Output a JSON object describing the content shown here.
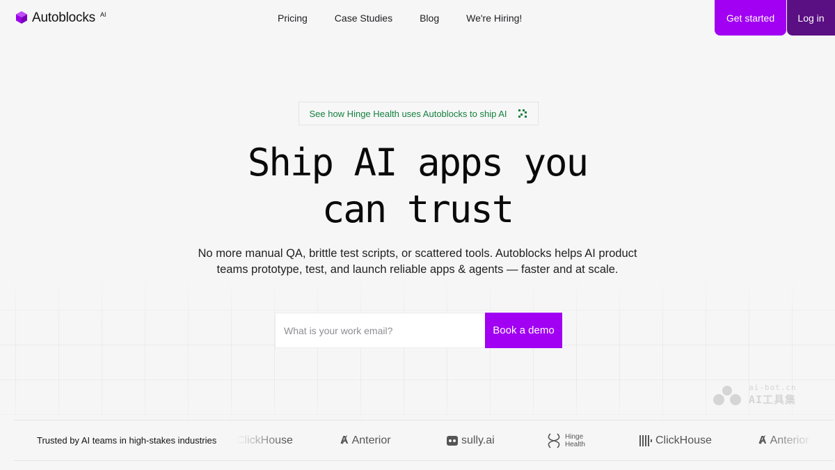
{
  "header": {
    "brand": "Autoblocks",
    "brand_sup": "AI",
    "nav": [
      {
        "label": "Pricing"
      },
      {
        "label": "Case Studies"
      },
      {
        "label": "Blog"
      },
      {
        "label": "We're Hiring!"
      }
    ],
    "get_started": "Get started",
    "login": "Log in"
  },
  "announcement": {
    "text": "See how Hinge Health uses Autoblocks to ship AI",
    "icon": "sparkle-grid-icon"
  },
  "hero": {
    "headline_line1": "Ship AI apps you",
    "headline_line2": "can trust",
    "subtext_line1": "No more manual QA, brittle test scripts, or scattered tools. Autoblocks helps AI product",
    "subtext_line2": "teams prototype, test, and launch reliable apps & agents — faster and at scale."
  },
  "form": {
    "email_placeholder": "What is your work email?",
    "submit_label": "Book a demo"
  },
  "trusted": {
    "label": "Trusted by AI teams in high-stakes industries",
    "logos": [
      {
        "name": "ClickHouse",
        "icon": "clickhouse-icon"
      },
      {
        "name": "Anterior",
        "icon": "anterior-icon"
      },
      {
        "name": "sully.ai",
        "icon": "sully-icon"
      },
      {
        "name_line1": "Hinge",
        "name_line2": "Health",
        "icon": "hinge-health-icon"
      },
      {
        "name": "ClickHouse",
        "icon": "clickhouse-icon"
      },
      {
        "name": "Anterior",
        "icon": "anterior-icon"
      }
    ]
  },
  "watermark": {
    "line1": "ai-bot.cn",
    "line2": "AI工具集"
  },
  "colors": {
    "accent": "#a100f2",
    "accent_dark": "#5a0f82",
    "announce_text": "#15803d",
    "background": "#f6f6f7"
  }
}
